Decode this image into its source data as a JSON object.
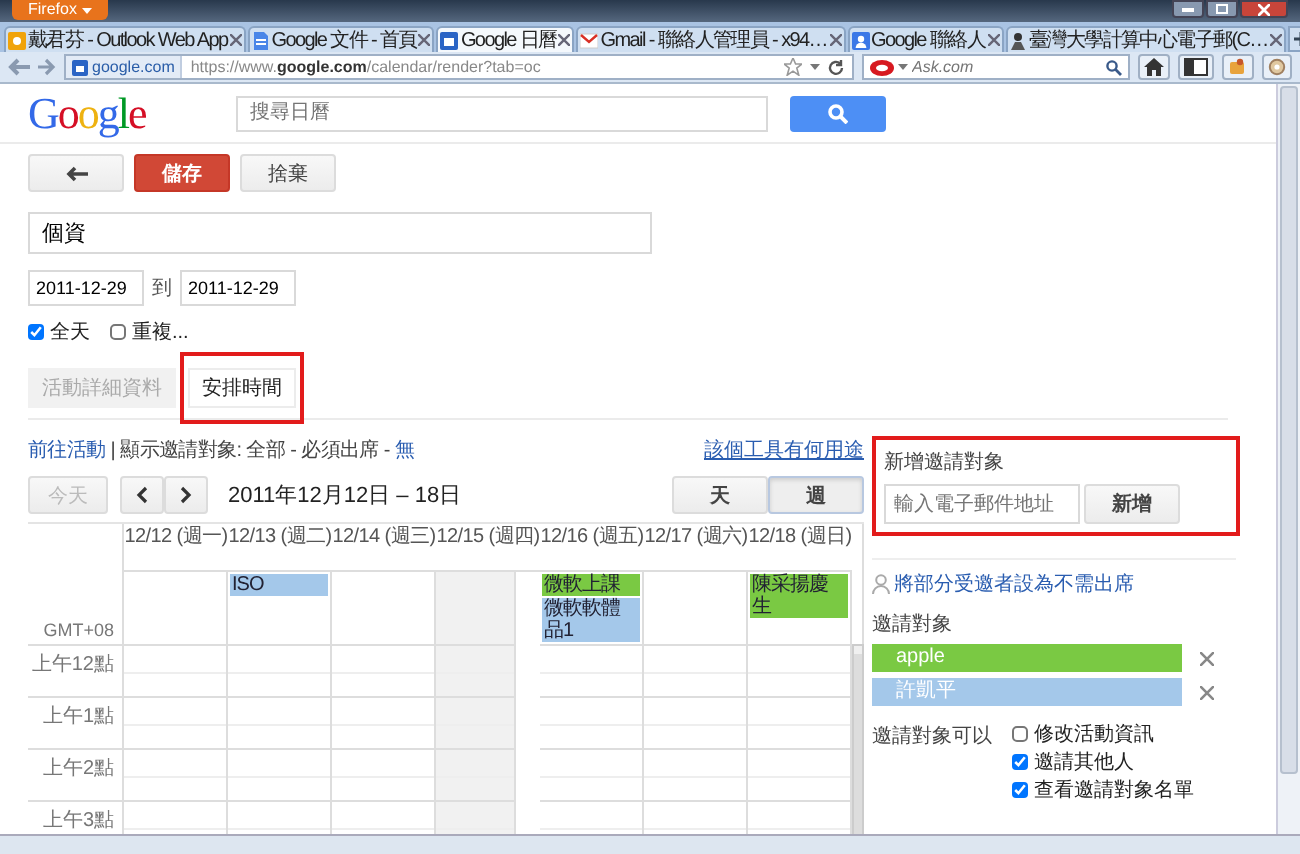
{
  "browser": {
    "app_menu": "Firefox",
    "tabs": [
      {
        "label": "戴君芬 - Outlook Web App",
        "kind": "office",
        "selected": false
      },
      {
        "label": "Google 文件 - 首頁",
        "kind": "document",
        "selected": false
      },
      {
        "label": "Google 日曆",
        "kind": "calendar",
        "selected": true
      },
      {
        "label": "Gmail - 聯絡人管理員 - x94…",
        "kind": "mail",
        "selected": false
      },
      {
        "label": "Google 聯絡人",
        "kind": "contacts",
        "selected": false
      },
      {
        "label": "臺灣大學計算中心電子郵(C…",
        "kind": "person",
        "selected": false
      }
    ],
    "site": "google.com",
    "url": "https://www.**google.com**/calendar/render?tab=oc",
    "search_placeholder": "Ask.com"
  },
  "header": {
    "logo": "Google",
    "search_placeholder": "搜尋日曆"
  },
  "toolbar": [
    {
      "kind": "back"
    },
    {
      "kind": "primary",
      "label": "儲存"
    },
    {
      "kind": "plain",
      "label": "捨棄"
    }
  ],
  "event": {
    "title": "個資",
    "start_date": "2011-12-29",
    "separator": "到",
    "end_date": "2011-12-29",
    "options": [
      {
        "label": "全天",
        "checked": true
      },
      {
        "label": "重複...",
        "checked": false
      }
    ]
  },
  "tabs": [
    {
      "label": "活動詳細資料",
      "selected": false,
      "highlighted": false
    },
    {
      "label": "安排時間",
      "selected": true,
      "highlighted": true
    }
  ],
  "filter_line": [
    {
      "kind": "link",
      "text": "前往活動"
    },
    {
      "kind": "text",
      "text": " | 顯示邀請對象: 全部 - 必須出席 - "
    },
    {
      "kind": "link",
      "text": "無"
    }
  ],
  "help_link": "該個工具有何用途",
  "nav": {
    "today": "今天",
    "today_disabled": true,
    "range": "2011年12月12日 – 18日",
    "views": [
      {
        "label": "天",
        "selected": false
      },
      {
        "label": "週",
        "selected": true
      }
    ]
  },
  "calendar": {
    "timezone": "GMT+08",
    "days": [
      {
        "label": "12/12 (週一)",
        "today": false
      },
      {
        "label": "12/13 (週二)",
        "today": false,
        "events": [
          {
            "title": "ISO",
            "color": "#a4c8ea"
          }
        ]
      },
      {
        "label": "12/14 (週三)",
        "today": false
      },
      {
        "label": "12/15 (週四)",
        "today": true
      },
      {
        "label": "12/16 (週五)",
        "today": false,
        "events": [
          {
            "title": "微軟上課",
            "color": "#7ac943"
          },
          {
            "title": "微軟軟體品1",
            "color": "#a4c8ea"
          }
        ]
      },
      {
        "label": "12/17 (週六)",
        "today": false
      },
      {
        "label": "12/18 (週日)",
        "today": false,
        "events": [
          {
            "title": "陳采揚慶生",
            "color": "#7ac943"
          }
        ]
      }
    ],
    "hours": [
      "上午12點",
      "上午1點",
      "上午2點",
      "上午3點"
    ]
  },
  "invite": {
    "highlighted": true,
    "label": "新增邀請對象",
    "placeholder": "輸入電子郵件地址",
    "button": "新增"
  },
  "optional_link": "將部分受邀者設為不需出席",
  "guests_label": "邀請對象",
  "guests": [
    {
      "name": "apple",
      "color": "#7ac943"
    },
    {
      "name": "許凱平",
      "color": "#a4c8ea"
    }
  ],
  "permissions": {
    "label": "邀請對象可以",
    "options": [
      {
        "label": "修改活動資訊",
        "checked": false
      },
      {
        "label": "邀請其他人",
        "checked": true
      },
      {
        "label": "查看邀請對象名單",
        "checked": true
      }
    ]
  }
}
